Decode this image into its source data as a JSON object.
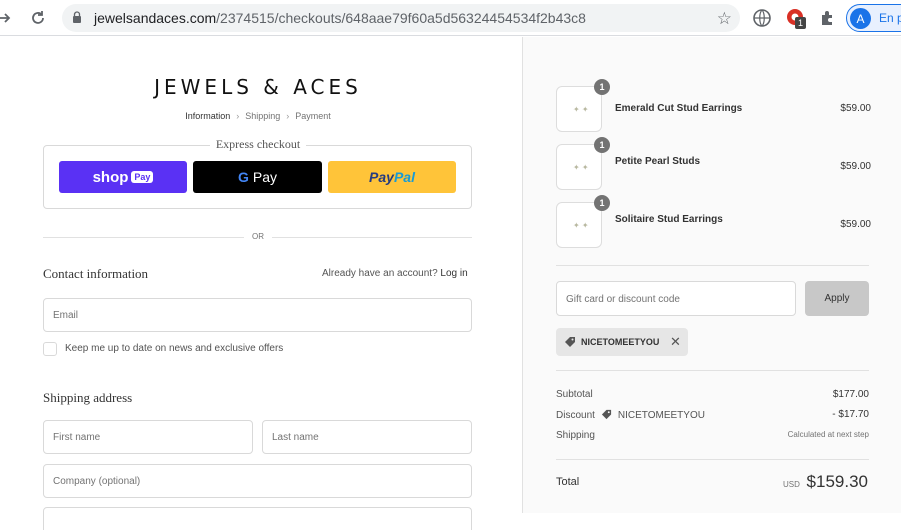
{
  "browser": {
    "url_host": "jewelsandaces.com",
    "url_path": "/2374515/checkouts/648aae79f60a5d56324454534f2b43c8",
    "profile_initial": "A",
    "profile_label": "En p",
    "extension_badge": "1"
  },
  "store": {
    "name": "JEWELS & ACES"
  },
  "breadcrumbs": [
    "Information",
    "Shipping",
    "Payment"
  ],
  "express": {
    "title": "Express checkout",
    "shop_label": "shop",
    "shop_pill": "Pay",
    "gpay_g": "G",
    "gpay_label": "Pay",
    "paypal_a": "Pay",
    "paypal_b": "Pal"
  },
  "or_label": "OR",
  "contact": {
    "title": "Contact information",
    "account_prompt": "Already have an account?",
    "login_label": "Log in",
    "email_placeholder": "Email",
    "newsletter_label": "Keep me up to date on news and exclusive offers"
  },
  "shipping": {
    "title": "Shipping address",
    "first_name_placeholder": "First name",
    "last_name_placeholder": "Last name",
    "company_placeholder": "Company (optional)"
  },
  "cart": {
    "items": [
      {
        "name": "Emerald Cut Stud Earrings",
        "qty": "1",
        "price": "$59.00"
      },
      {
        "name": "Petite Pearl Studs",
        "qty": "1",
        "price": "$59.00"
      },
      {
        "name": "Solitaire Stud Earrings",
        "qty": "1",
        "price": "$59.00"
      }
    ],
    "discount_placeholder": "Gift card or discount code",
    "apply_label": "Apply",
    "applied_code": "NICETOMEETYOU",
    "subtotal_label": "Subtotal",
    "subtotal_value": "$177.00",
    "discount_label": "Discount",
    "discount_code": "NICETOMEETYOU",
    "discount_value": "- $17.70",
    "shipping_label": "Shipping",
    "shipping_value": "Calculated at next step",
    "total_label": "Total",
    "currency": "USD",
    "total_value": "$159.30"
  },
  "colors": {
    "shop_pay": "#5a31f4",
    "google_pay": "#000000",
    "paypal": "#ffc439",
    "qty_badge": "#737373"
  }
}
